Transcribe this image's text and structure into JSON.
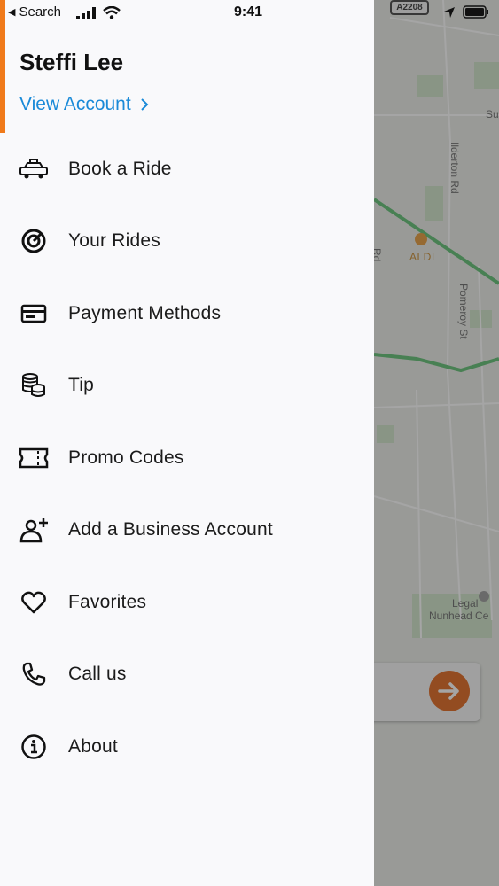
{
  "status_bar": {
    "back_label": "Search",
    "time": "9:41"
  },
  "map": {
    "road_badge": "A2208",
    "labels": {
      "ilderton": "Ilderton Rd",
      "pomeroy": "Pomeroy St",
      "su": "Su",
      "rd": "Rd",
      "poi": "ALDI",
      "legal": "Legal",
      "nunhead": "Nunhead Ce"
    }
  },
  "drawer": {
    "user_name": "Steffi Lee",
    "view_account": "View Account",
    "menu": [
      {
        "label": "Book a Ride",
        "icon": "taxi-icon"
      },
      {
        "label": "Your Rides",
        "icon": "rides-history-icon"
      },
      {
        "label": "Payment Methods",
        "icon": "credit-card-icon"
      },
      {
        "label": "Tip",
        "icon": "coins-icon"
      },
      {
        "label": "Promo Codes",
        "icon": "ticket-icon"
      },
      {
        "label": "Add a Business Account",
        "icon": "add-user-icon"
      },
      {
        "label": "Favorites",
        "icon": "heart-icon"
      },
      {
        "label": "Call us",
        "icon": "phone-icon"
      },
      {
        "label": "About",
        "icon": "info-icon"
      }
    ]
  },
  "colors": {
    "accent": "#f07a1a",
    "link": "#1a8ad8",
    "go_button": "#e1661c"
  }
}
